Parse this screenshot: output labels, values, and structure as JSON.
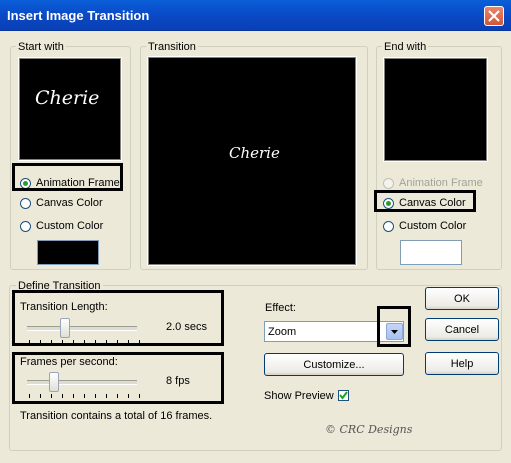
{
  "window": {
    "title": "Insert Image Transition"
  },
  "start_with": {
    "legend": "Start with",
    "preview_text": "Cherie",
    "options": [
      "Animation Frame",
      "Canvas Color",
      "Custom Color"
    ],
    "selected": "Animation Frame",
    "custom_color": "#000000"
  },
  "transition": {
    "legend": "Transition",
    "preview_text": "Cherie"
  },
  "end_with": {
    "legend": "End with",
    "options": [
      "Animation Frame",
      "Canvas Color",
      "Custom Color"
    ],
    "selected": "Canvas Color",
    "disabled": "Animation Frame",
    "custom_color": "#ffffff"
  },
  "define_transition": {
    "legend": "Define Transition",
    "length_label": "Transition Length:",
    "length_value": "2.0 secs",
    "length_position": 0.33,
    "fps_label": "Frames per second:",
    "fps_value": "8 fps",
    "fps_position": 0.22,
    "summary": "Transition contains a total of 16 frames."
  },
  "effect": {
    "label": "Effect:",
    "selected": "Zoom",
    "customize_label": "Customize...",
    "show_preview_label": "Show Preview",
    "show_preview_checked": true
  },
  "buttons": {
    "ok": "OK",
    "cancel": "Cancel",
    "help": "Help"
  },
  "watermark": "© CRC Designs",
  "colors": {
    "titlebar": "#0a4ecb",
    "dialog_bg": "#ece9d8",
    "preview_bg": "#000000"
  }
}
